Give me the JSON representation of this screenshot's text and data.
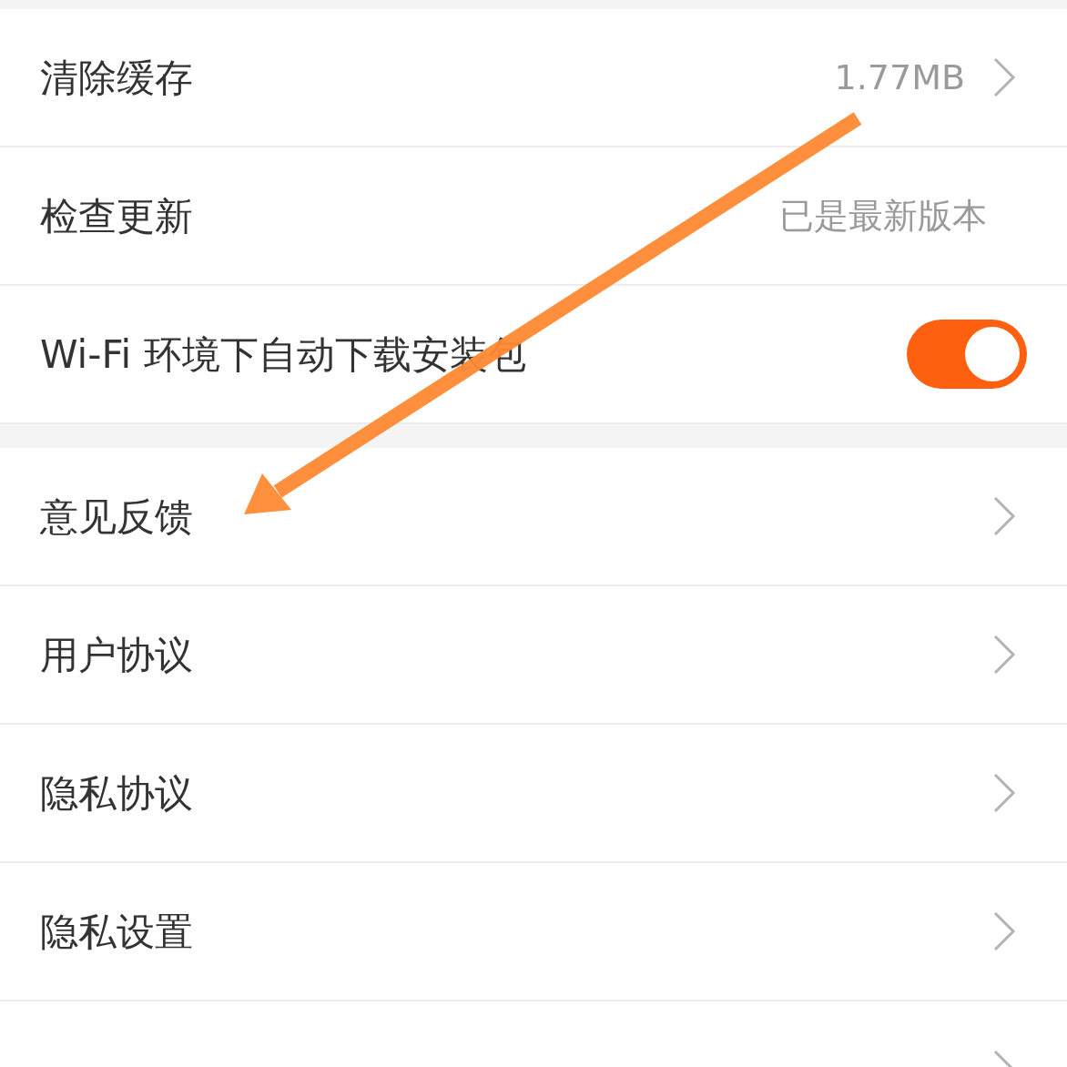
{
  "sections": [
    {
      "rows": [
        {
          "kind": "chevron",
          "label": "清除缓存",
          "value": "1.77MB"
        },
        {
          "kind": "text",
          "label": "检查更新",
          "value": "已是最新版本"
        },
        {
          "kind": "toggle",
          "label": "Wi-Fi 环境下自动下载安装包",
          "on": true
        }
      ]
    },
    {
      "rows": [
        {
          "kind": "chevron",
          "label": "意见反馈"
        },
        {
          "kind": "chevron",
          "label": "用户协议"
        },
        {
          "kind": "chevron",
          "label": "隐私协议"
        },
        {
          "kind": "chevron",
          "label": "隐私设置"
        },
        {
          "kind": "chevron"
        }
      ]
    }
  ]
}
